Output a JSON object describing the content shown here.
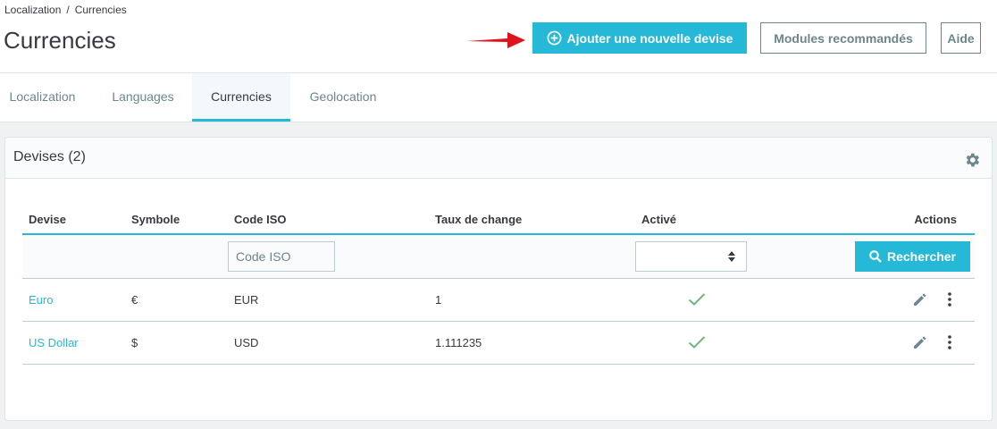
{
  "breadcrumb": {
    "parent": "Localization",
    "current": "Currencies",
    "separator": "/"
  },
  "page_title": "Currencies",
  "toolbar": {
    "add_label": "Ajouter une nouvelle devise",
    "modules_label": "Modules recommandés",
    "help_label": "Aide"
  },
  "tabs": [
    {
      "label": "Localization"
    },
    {
      "label": "Languages"
    },
    {
      "label": "Currencies",
      "active": true
    },
    {
      "label": "Geolocation"
    }
  ],
  "card": {
    "title": "Devises (2)"
  },
  "table": {
    "columns": [
      "Devise",
      "Symbole",
      "Code ISO",
      "Taux de change",
      "Activé",
      "Actions"
    ],
    "filter": {
      "iso_placeholder": "Code ISO",
      "search_label": "Rechercher"
    },
    "rows": [
      {
        "name": "Euro",
        "symbol": "€",
        "iso": "EUR",
        "rate": "1",
        "active": true
      },
      {
        "name": "US Dollar",
        "symbol": "$",
        "iso": "USD",
        "rate": "1.111235",
        "active": true
      }
    ]
  },
  "colors": {
    "accent": "#25b9d7",
    "check": "#70b580",
    "text": "#363a41",
    "muted": "#6c868e"
  },
  "icons": [
    "plus-circle-icon",
    "gear-icon",
    "search-icon",
    "check-icon",
    "edit-icon",
    "more-vertical-icon",
    "sort-caret-icon"
  ]
}
